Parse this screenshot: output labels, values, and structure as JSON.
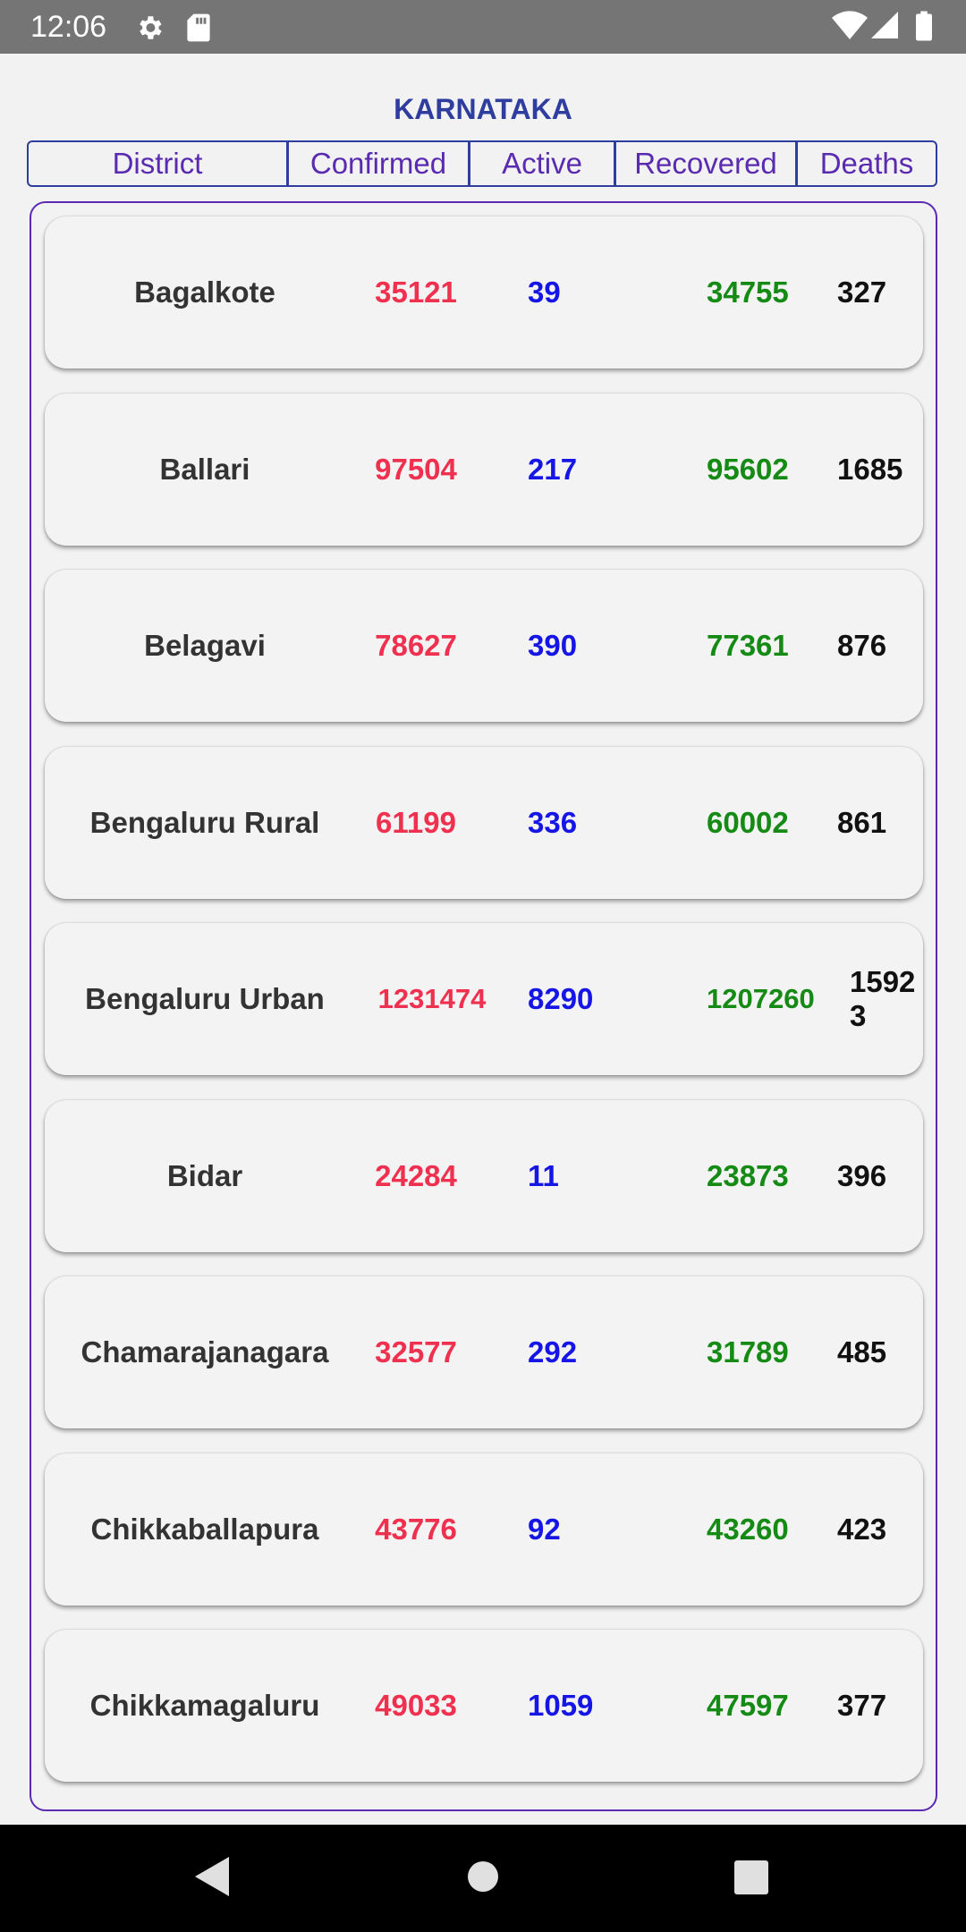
{
  "status_bar": {
    "time": "12:06",
    "icons": [
      "settings-gear-icon",
      "sd-card-icon",
      "wifi-icon",
      "cell-signal-icon",
      "battery-icon"
    ]
  },
  "title": "KARNATAKA",
  "columns": {
    "district": "District",
    "confirmed": "Confirmed",
    "active": "Active",
    "recovered": "Recovered",
    "deaths": "Deaths"
  },
  "colors": {
    "accent": "#2f3e9e",
    "header_text": "#5a2bb0",
    "confirmed": "#f0304f",
    "active": "#1515e6",
    "recovered": "#158a15",
    "deaths": "#111111"
  },
  "rows": [
    {
      "district": "Bagalkote",
      "confirmed": "35121",
      "active": "39",
      "recovered": "34755",
      "deaths": "327"
    },
    {
      "district": "Ballari",
      "confirmed": "97504",
      "active": "217",
      "recovered": "95602",
      "deaths": "1685"
    },
    {
      "district": "Belagavi",
      "confirmed": "78627",
      "active": "390",
      "recovered": "77361",
      "deaths": "876"
    },
    {
      "district": "Bengaluru Rural",
      "confirmed": "61199",
      "active": "336",
      "recovered": "60002",
      "deaths": "861"
    },
    {
      "district": "Bengaluru Urban",
      "confirmed": "1231474",
      "active": "8290",
      "recovered": "1207260",
      "deaths": "15923"
    },
    {
      "district": "Bidar",
      "confirmed": "24284",
      "active": "11",
      "recovered": "23873",
      "deaths": "396"
    },
    {
      "district": "Chamarajanagara",
      "confirmed": "32577",
      "active": "292",
      "recovered": "31789",
      "deaths": "485"
    },
    {
      "district": "Chikkaballapura",
      "confirmed": "43776",
      "active": "92",
      "recovered": "43260",
      "deaths": "423"
    },
    {
      "district": "Chikkamagaluru",
      "confirmed": "49033",
      "active": "1059",
      "recovered": "47597",
      "deaths": "377"
    }
  ],
  "nav_bar": {
    "buttons": [
      "back-icon",
      "home-icon",
      "recents-icon"
    ]
  }
}
